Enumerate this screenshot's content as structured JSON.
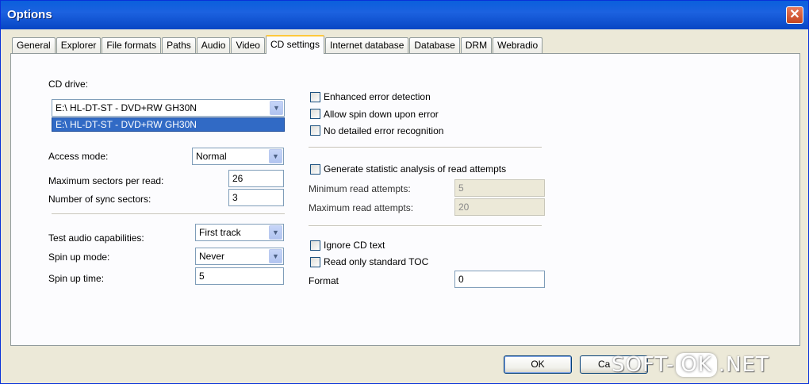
{
  "window": {
    "title": "Options",
    "close_label": "✕"
  },
  "tabs": [
    {
      "label": "General"
    },
    {
      "label": "Explorer"
    },
    {
      "label": "File formats"
    },
    {
      "label": "Paths"
    },
    {
      "label": "Audio"
    },
    {
      "label": "Video"
    },
    {
      "label": "CD settings",
      "active": true
    },
    {
      "label": "Internet database"
    },
    {
      "label": "Database"
    },
    {
      "label": "DRM"
    },
    {
      "label": "Webradio"
    }
  ],
  "left": {
    "cd_drive_label": "CD drive:",
    "cd_drive_value": "E:\\ HL-DT-ST - DVD+RW GH30N",
    "cd_drive_option": "E:\\ HL-DT-ST - DVD+RW GH30N",
    "access_mode_label": "Access mode:",
    "access_mode_value": "Normal",
    "max_sectors_label": "Maximum sectors per read:",
    "max_sectors_value": "26",
    "sync_sectors_label": "Number of sync sectors:",
    "sync_sectors_value": "3",
    "test_audio_label": "Test audio capabilities:",
    "test_audio_value": "First track",
    "spin_up_mode_label": "Spin up mode:",
    "spin_up_mode_value": "Never",
    "spin_up_time_label": "Spin up time:",
    "spin_up_time_value": "5"
  },
  "right": {
    "enhanced_error": "Enhanced error detection",
    "allow_spin_down": "Allow spin down upon error",
    "no_detailed_error": "No detailed error recognition",
    "generate_stats": "Generate statistic analysis of read attempts",
    "min_attempts_label": "Minimum read attempts:",
    "min_attempts_value": "5",
    "max_attempts_label": "Maximum read attempts:",
    "max_attempts_value": "20",
    "ignore_cd_text": "Ignore CD text",
    "read_std_toc": "Read only standard TOC",
    "format_label": "Format",
    "format_value": "0"
  },
  "buttons": {
    "ok": "OK",
    "cancel": "Ca"
  },
  "watermark": {
    "left": "SOFT-",
    "mid": "OK",
    "right": ".NET"
  },
  "icons": {
    "dropdown_arrow": "▼"
  }
}
